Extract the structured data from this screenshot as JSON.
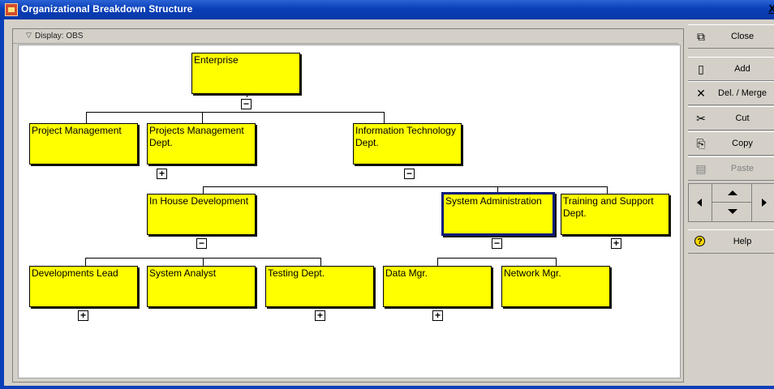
{
  "window": {
    "title": "Organizational Breakdown Structure",
    "close_glyph": "X"
  },
  "display": {
    "label": "Display: OBS"
  },
  "nodes": {
    "enterprise": "Enterprise",
    "project_management": "Project Management",
    "projects_management_dept": "Projects Management Dept.",
    "information_technology_dept": "Information Technology Dept.",
    "in_house_development": "In House Development",
    "system_administration": "System Administration",
    "training_and_support_dept": "Training and Support Dept.",
    "developments_lead": "Developments Lead",
    "system_analyst": "System Analyst",
    "testing_dept": "Testing Dept.",
    "data_mgr": "Data Mgr.",
    "network_mgr": "Network Mgr."
  },
  "toggles": {
    "collapse": "−",
    "expand": "+"
  },
  "sidebar": {
    "close": "Close",
    "add": "Add",
    "del_merge": "Del. / Merge",
    "cut": "Cut",
    "copy": "Copy",
    "paste": "Paste",
    "help": "Help"
  },
  "icons": {
    "close": "📤",
    "add": "🗋",
    "del_merge": "✕",
    "cut": "✂",
    "copy": "📄",
    "paste": "📋",
    "help": "?"
  },
  "colors": {
    "node_fill": "#ffff00",
    "selection_border": "#0a1a7a",
    "titlebar": "#0a3fb8"
  }
}
